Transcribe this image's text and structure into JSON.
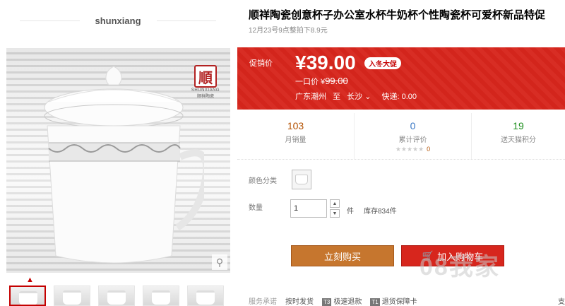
{
  "shop": {
    "name": "shunxiang"
  },
  "product": {
    "title": "顺祥陶瓷创意杯子办公室水杯牛奶杯个性陶瓷杯可爱杯新品特促",
    "subtitle": "12月23号9点整拍下8.9元",
    "logo": {
      "char": "順",
      "en": "SHUNXIANG",
      "cn": "顺祥陶瓷"
    }
  },
  "price": {
    "label": "促销价",
    "value": "¥39.00",
    "promo_tag": "入冬大促",
    "original_label": "一口价 ¥",
    "original_value": "99.00",
    "shipping_from": "广东潮州",
    "shipping_to_word": "至",
    "shipping_to": "长沙",
    "shipping_fee": "快递: 0.00"
  },
  "stats": {
    "monthly_sales": {
      "num": "103",
      "label": "月销量"
    },
    "reviews": {
      "num": "0",
      "label": "累计评价",
      "stars": "★★★★★",
      "score": "0"
    },
    "points": {
      "num": "19",
      "label": "送天猫积分"
    }
  },
  "options": {
    "color_label": "颜色分类",
    "qty_label": "数量",
    "qty_value": "1",
    "unit": "件",
    "stock": "库存834件"
  },
  "actions": {
    "buy": "立刻购买",
    "cart": "加入购物车"
  },
  "service": {
    "label": "服务承诺",
    "items": [
      "按时发货",
      "极速退款",
      "退货保障卡"
    ],
    "badges": [
      "T3",
      "T1"
    ],
    "tail": "支"
  },
  "watermark": "08我家"
}
